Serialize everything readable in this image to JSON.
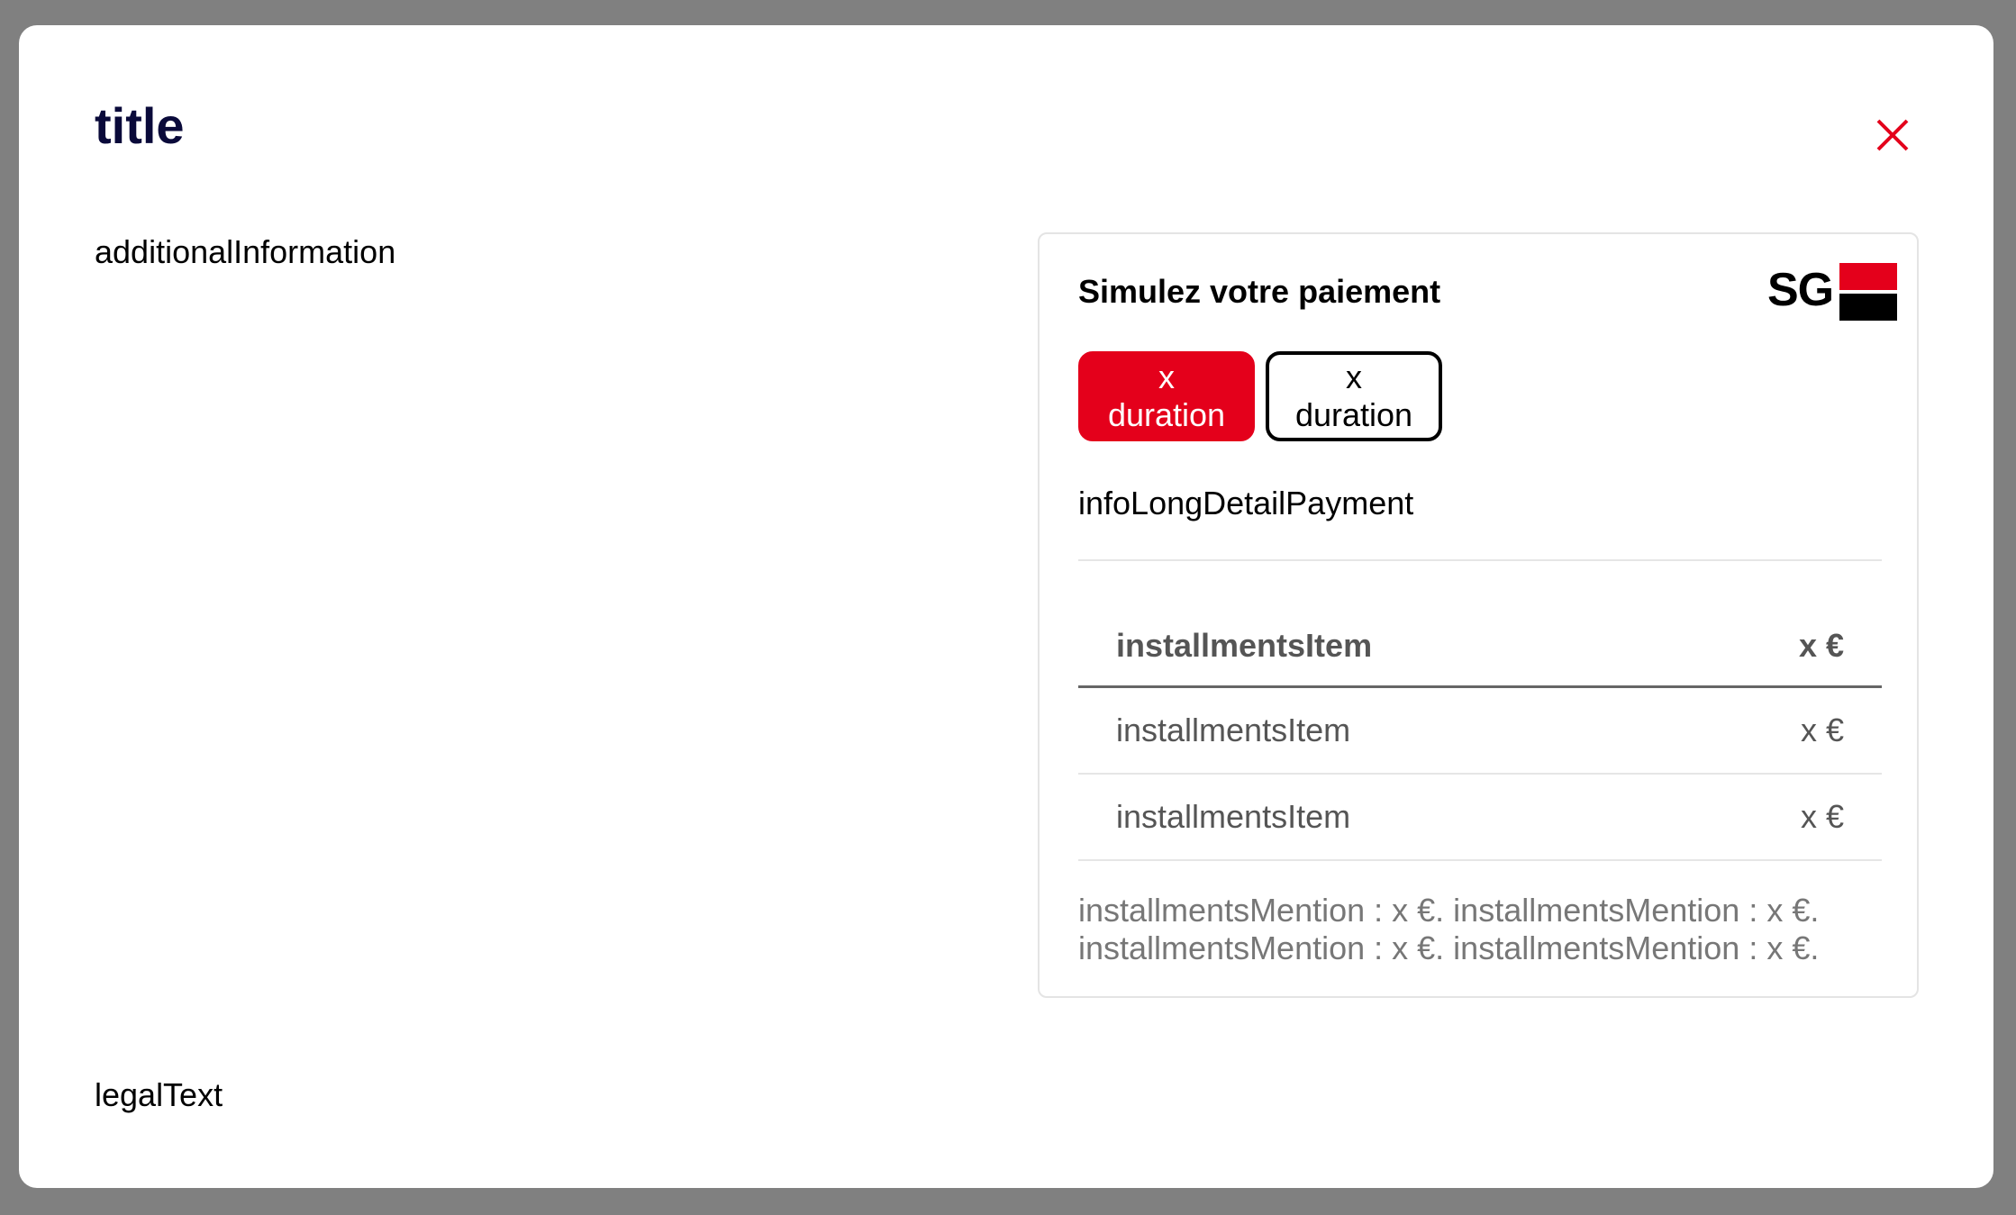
{
  "modal": {
    "title": "title",
    "close_icon": "close-icon",
    "additional_information": "additionalInformation",
    "legal_text": "legalText"
  },
  "simulator": {
    "title": "Simulez votre paiement",
    "logo_text": "SG",
    "durations": [
      {
        "label": "x duration",
        "selected": true
      },
      {
        "label": "x duration",
        "selected": false
      }
    ],
    "info_long_detail": "infoLongDetailPayment",
    "installments": [
      {
        "label": "installmentsItem",
        "amount": "x €"
      },
      {
        "label": "installmentsItem",
        "amount": "x €"
      },
      {
        "label": "installmentsItem",
        "amount": "x €"
      }
    ],
    "mention_line1": "installmentsMention : x €. installmentsMention : x €.",
    "mention_line2": "installmentsMention : x €. installmentsMention : x €."
  },
  "colors": {
    "accent": "#e4001b",
    "title": "#0a0a3a",
    "overlay": "#808080"
  }
}
